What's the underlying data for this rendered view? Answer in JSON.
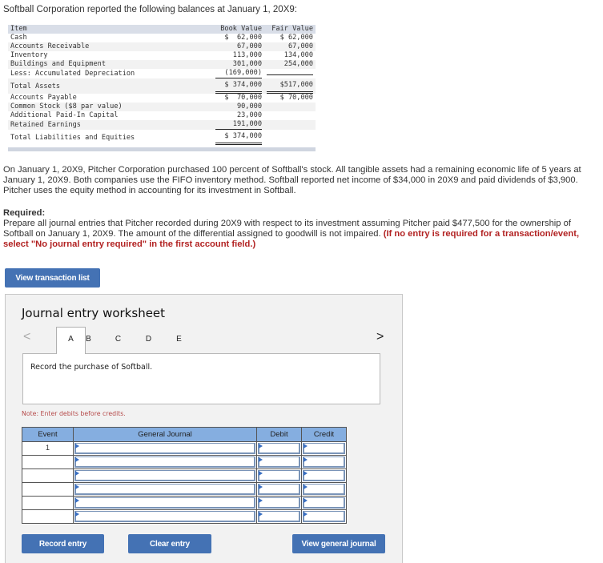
{
  "intro": "Softball Corporation reported the following balances at January 1, 20X9:",
  "balance_table": {
    "headers": [
      "Item",
      "Book Value",
      "Fair Value"
    ],
    "rows": [
      {
        "item": "Cash",
        "book": "$  62,000",
        "fair": "$ 62,000"
      },
      {
        "item": "Accounts Receivable",
        "book": "67,000",
        "fair": "67,000"
      },
      {
        "item": "Inventory",
        "book": "113,000",
        "fair": "134,000"
      },
      {
        "item": "Buildings and Equipment",
        "book": "301,000",
        "fair": "254,000"
      },
      {
        "item": "Less: Accumulated Depreciation",
        "book": "(169,000)",
        "fair": ""
      },
      {
        "item": "Total Assets",
        "book": "$ 374,000",
        "fair": "$517,000"
      },
      {
        "item": "Accounts Payable",
        "book": "$  70,000",
        "fair": "$ 70,000"
      },
      {
        "item": "Common Stock ($8 par value)",
        "book": "90,000",
        "fair": ""
      },
      {
        "item": "Additional Paid-In Capital",
        "book": "23,000",
        "fair": ""
      },
      {
        "item": "Retained Earnings",
        "book": "191,000",
        "fair": ""
      },
      {
        "item": "Total Liabilities and Equities",
        "book": "$ 374,000",
        "fair": ""
      }
    ]
  },
  "paragraph1": "On January 1, 20X9, Pitcher Corporation purchased 100 percent of Softball's stock. All tangible assets had a remaining economic life of 5 years at January 1, 20X9. Both companies use the FIFO inventory method. Softball reported net income of $34,000 in 20X9 and paid dividends of $3,900. Pitcher uses the equity method in accounting for its investment in Softball.",
  "required": {
    "title": "Required:",
    "text": "Prepare all journal entries that Pitcher recorded during 20X9 with respect to its investment assuming Pitcher paid $477,500 for the ownership of Softball on January 1, 20X9. The amount of the differential assigned to goodwill is not impaired. ",
    "instruction": "(If no entry is required for a transaction/event, select \"No journal entry required\" in the first account field.)"
  },
  "buttons": {
    "view_transaction_list": "View transaction list",
    "record_entry": "Record entry",
    "clear_entry": "Clear entry",
    "view_general_journal": "View general journal"
  },
  "worksheet": {
    "title": "Journal entry worksheet",
    "prev_icon": "<",
    "next_icon": ">",
    "tabs": [
      "A",
      "B",
      "C",
      "D",
      "E"
    ],
    "active_tab": "A",
    "prompt": "Record the purchase of Softball.",
    "note": "Note: Enter debits before credits.",
    "columns": [
      "Event",
      "General Journal",
      "Debit",
      "Credit"
    ],
    "rows": [
      {
        "event": "1",
        "account": "",
        "debit": "",
        "credit": ""
      },
      {
        "event": "",
        "account": "",
        "debit": "",
        "credit": ""
      },
      {
        "event": "",
        "account": "",
        "debit": "",
        "credit": ""
      },
      {
        "event": "",
        "account": "",
        "debit": "",
        "credit": ""
      },
      {
        "event": "",
        "account": "",
        "debit": "",
        "credit": ""
      },
      {
        "event": "",
        "account": "",
        "debit": "",
        "credit": ""
      }
    ]
  },
  "colors": {
    "button_blue": "#4472b4",
    "table_header_blue": "#85aee0",
    "instruction_red": "#b22222",
    "note_red": "#b54a4a"
  }
}
